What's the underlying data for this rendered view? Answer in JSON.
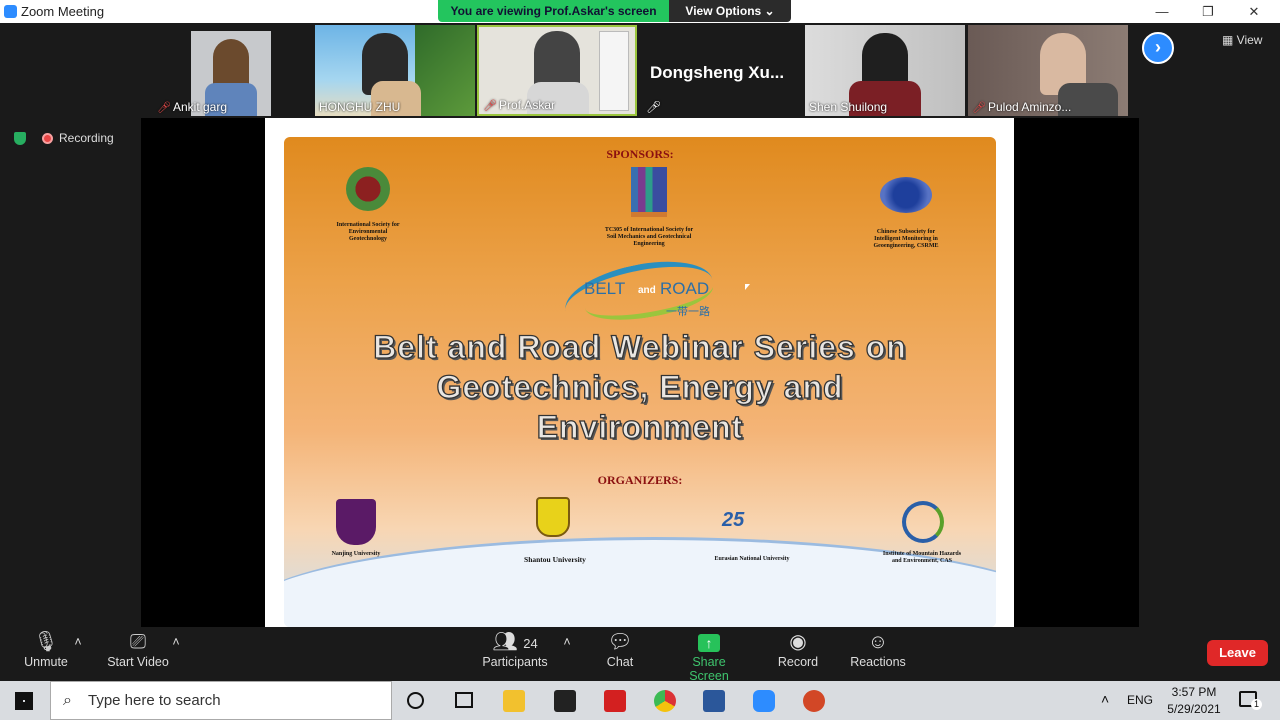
{
  "window": {
    "title": "Zoom Meeting",
    "minimize": "—",
    "restore": "❐",
    "close": "✕"
  },
  "banner": {
    "viewing": "You are viewing Prof.Askar's screen",
    "view_options": "View Options ⌄"
  },
  "participants_strip": [
    {
      "name": "Ankit garg",
      "muted": true
    },
    {
      "name": "HONGHU ZHU",
      "muted": false
    },
    {
      "name": "Prof.Askar",
      "muted": true
    },
    {
      "name": "Dongsheng  Xu...",
      "muted": true
    },
    {
      "name": "Shen Shuilong",
      "muted": false
    },
    {
      "name": "Pulod Aminzo...",
      "muted": true
    }
  ],
  "view_button": "View",
  "recording": "Recording",
  "slide": {
    "sponsors_heading": "SPONSORS:",
    "sponsor1": "International Society for Environmental Geotechnology",
    "sponsor2": "TC305 of International Society for Soil Mechanics and Geotechnical Engineering",
    "sponsor3": "Chinese Subsociety for Intelligent Monitoring in Geoengineering, CSRME",
    "logo_belt": "BELT",
    "logo_and": "and",
    "logo_road": "ROAD",
    "logo_chinese": "一带一路",
    "title_line1": "Belt and Road Webinar Series on",
    "title_line2": "Geotechnics, Energy and",
    "title_line3": "Environment",
    "organizers_heading": "ORGANIZERS:",
    "org1": "Nanjing University",
    "org2": "Shantou University",
    "org3": "Eurasian National University",
    "org4": "Institute of Mountain Hazards and Environment, CAS"
  },
  "toolbar": {
    "unmute": "Unmute",
    "start_video": "Start Video",
    "participants": "Participants",
    "participant_count": "24",
    "chat": "Chat",
    "share_screen": "Share Screen",
    "record": "Record",
    "reactions": "Reactions",
    "leave": "Leave"
  },
  "taskbar": {
    "search_placeholder": "Type here to search",
    "lang": "ENG",
    "time": "3:57 PM",
    "date": "5/29/2021",
    "notif_count": "1"
  }
}
